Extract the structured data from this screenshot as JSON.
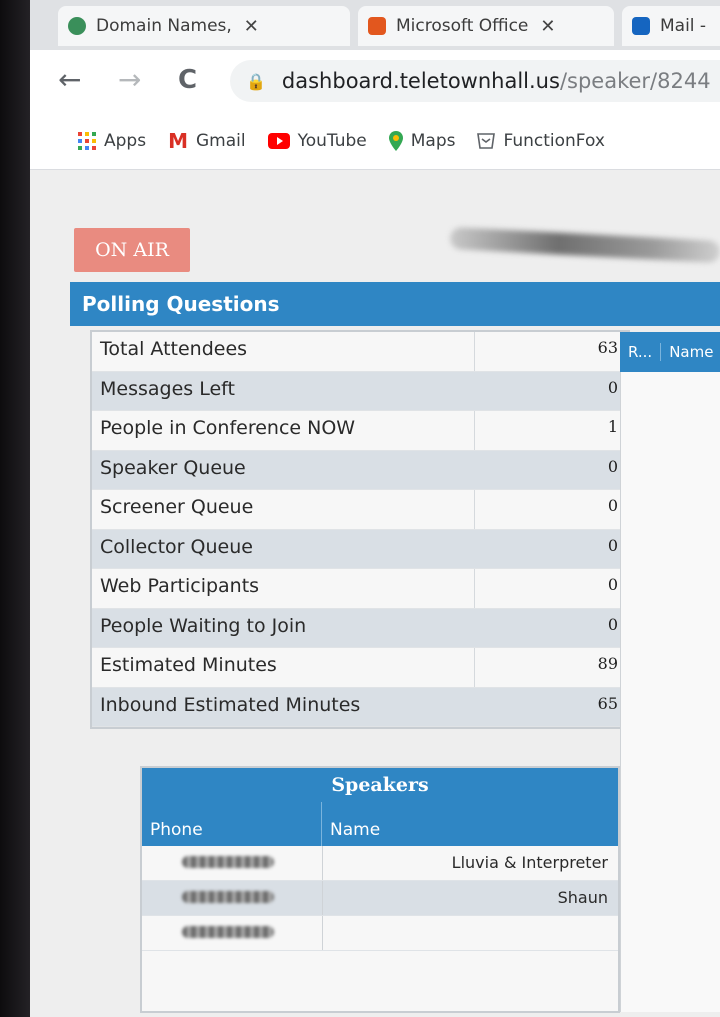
{
  "browser": {
    "tabs": [
      {
        "label": "Domain Names,",
        "favicon_color": "#3a8f5a"
      },
      {
        "label": "Microsoft Office",
        "favicon_color": "#e2571e"
      },
      {
        "label": "Mail -",
        "favicon_color": "#1565c0"
      }
    ],
    "nav": {
      "back": "←",
      "forward": "→",
      "reload": "C"
    },
    "url": {
      "host": "dashboard.teletownhall.us",
      "path": "/speaker/8244"
    },
    "bookmarks": [
      {
        "label": "Apps",
        "icon": "apps-grid-icon"
      },
      {
        "label": "Gmail",
        "icon": "gmail-icon"
      },
      {
        "label": "YouTube",
        "icon": "youtube-icon"
      },
      {
        "label": "Maps",
        "icon": "maps-pin-icon"
      },
      {
        "label": "FunctionFox",
        "icon": "functionfox-icon"
      }
    ]
  },
  "dashboard": {
    "on_air_label": "ON AIR",
    "polling_title": "Polling Questions",
    "stats": [
      {
        "label": "Total Attendees",
        "value": "63"
      },
      {
        "label": "Messages Left",
        "value": "0"
      },
      {
        "label": "People in Conference NOW",
        "value": "1"
      },
      {
        "label": "Speaker Queue",
        "value": "0"
      },
      {
        "label": "Screener Queue",
        "value": "0"
      },
      {
        "label": "Collector Queue",
        "value": "0"
      },
      {
        "label": "Web Participants",
        "value": "0"
      },
      {
        "label": "People Waiting to Join",
        "value": "0"
      },
      {
        "label": "Estimated Minutes",
        "value": "89"
      },
      {
        "label": "Inbound Estimated Minutes",
        "value": "65"
      }
    ],
    "side_table": {
      "columns": [
        "R...",
        "Name"
      ]
    },
    "speakers": {
      "title": "Speakers",
      "columns": {
        "phone": "Phone",
        "name": "Name"
      },
      "rows": [
        {
          "name": "Lluvia & Interpreter"
        },
        {
          "name": "Shaun"
        },
        {
          "name": ""
        }
      ]
    }
  },
  "colors": {
    "accent": "#2f86c4",
    "on_air": "#e98b80",
    "row_alt": "#d9dfe5"
  }
}
